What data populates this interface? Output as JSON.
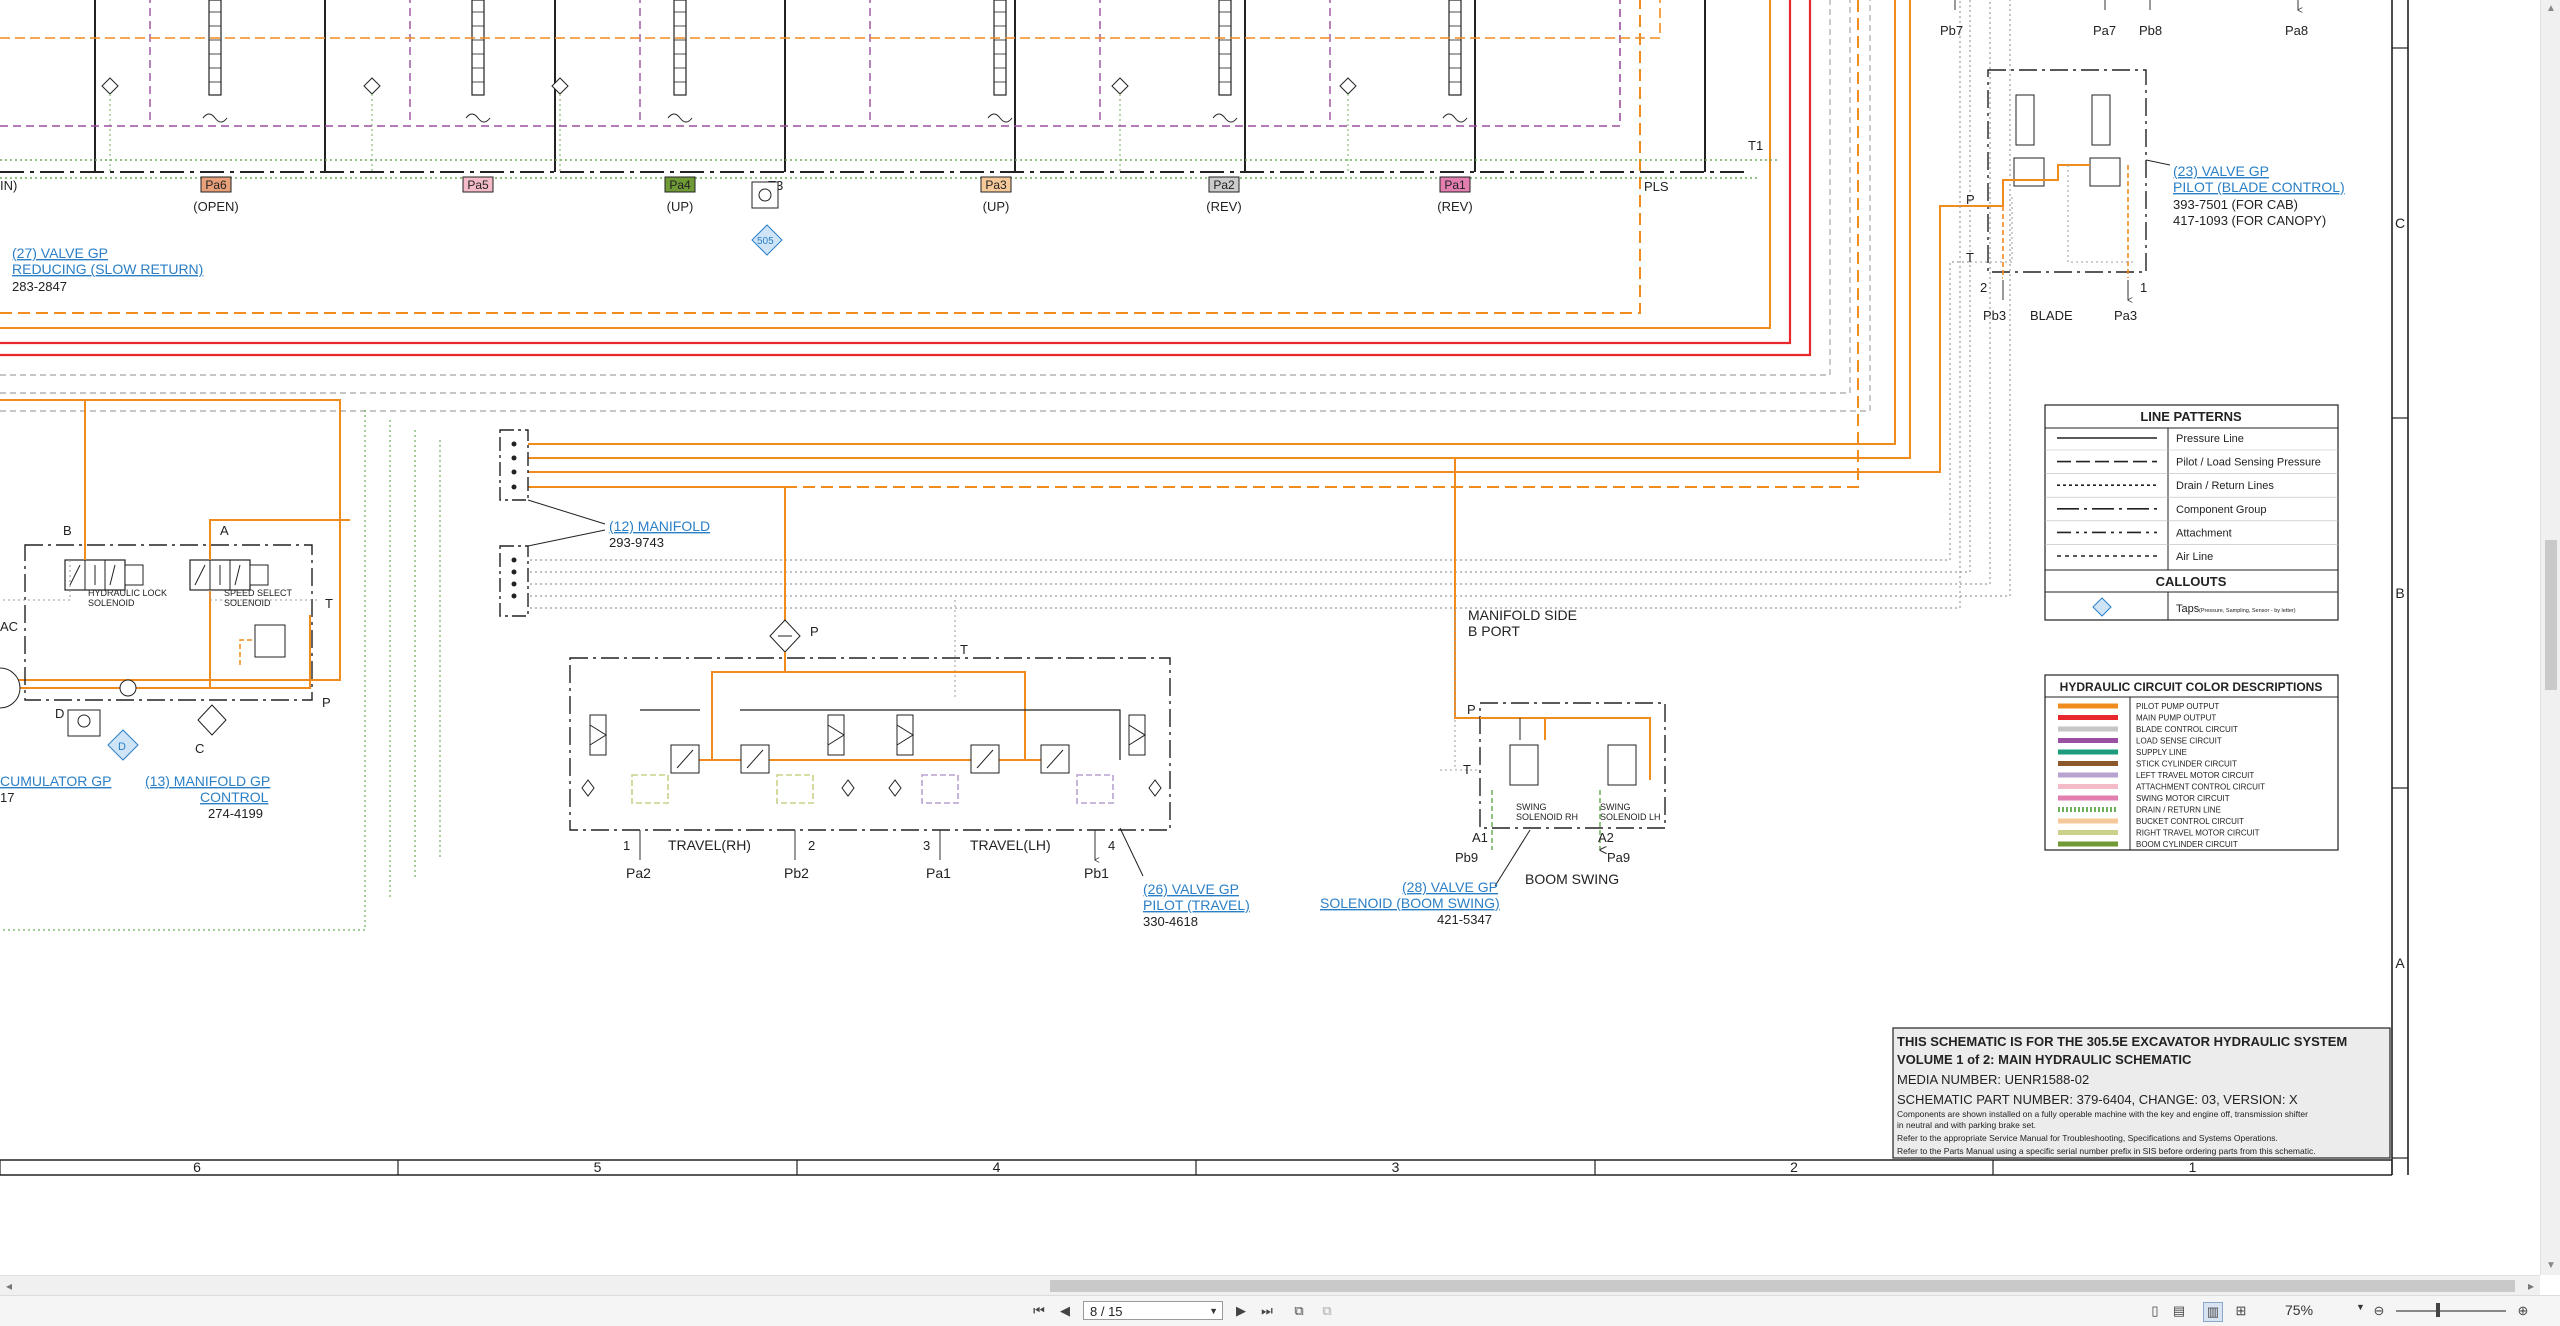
{
  "colors": {
    "pilot_pump_output": "#f08c1e",
    "main_pump_output": "#e8282d",
    "blade_control": "#c6c6c6",
    "load_sense": "#9b4fa0",
    "supply_line": "#1e9c7e",
    "stick_cylinder": "#8c5a2a",
    "left_travel_motor": "#b9a2d0",
    "attachment_control": "#f4bcc8",
    "swing_motor": "#e37fb0",
    "drain_return": "#6fae5a",
    "bucket_control": "#f6c99a",
    "right_travel_motor": "#cbd08a",
    "boom_cylinder": "#6f9a35",
    "link": "#2a7fc6",
    "tap": "#2a7fc6"
  },
  "schematic": {
    "ports_top": [
      {
        "id": "Pa6",
        "sub": "(OPEN)",
        "color": "#e8a07a"
      },
      {
        "id": "Pa5",
        "sub": "",
        "color": "#f4bcc8"
      },
      {
        "id": "Pa4",
        "sub": "(UP)",
        "color": "#6f9a35"
      },
      {
        "id": "Pa3",
        "sub": "(UP)",
        "color": "#f6c99a"
      },
      {
        "id": "Pa2",
        "sub": "(REV)",
        "color": "#cbcbcb"
      },
      {
        "id": "Pa1",
        "sub": "(REV)",
        "color": "#e37fb0"
      }
    ],
    "in_label": "IN)",
    "t3_label": "T3",
    "tap_label": "505",
    "t1_label": "T1",
    "pls_label": "PLS",
    "top_right_ports": [
      "Pb7",
      "Pa7",
      "Pb8",
      "Pa8"
    ],
    "valve27": {
      "title": "(27) VALVE GP",
      "sub": "REDUCING (SLOW RETURN)",
      "part": "283-2847"
    },
    "valve23": {
      "title": "(23) VALVE GP",
      "sub": "PILOT (BLADE CONTROL)",
      "part1": "393-7501 (FOR CAB)",
      "part2": "417-1093 (FOR CANOPY)"
    },
    "blade": {
      "p": "P",
      "t": "T",
      "n2": "2",
      "n1": "1",
      "pb3": "Pb3",
      "blade": "BLADE",
      "pa3": "Pa3"
    },
    "manifold12": {
      "title": "(12) MANIFOLD",
      "part": "293-9743"
    },
    "manifold13": {
      "title": "(13) MANIFOLD GP",
      "sub": "CONTROL",
      "part": "274-4199"
    },
    "accumulator": {
      "title": "CUMULATOR GP",
      "part": "17",
      "ac": "AC"
    },
    "solenoids": {
      "b": "B",
      "a": "A",
      "t": "T",
      "p": "P",
      "d": "D",
      "c": "C",
      "tap_d": "D",
      "lock": "HYDRAULIC LOCK",
      "lock2": "SOLENOID",
      "speed": "SPEED SELECT",
      "speed2": "SOLENOID"
    },
    "travel": {
      "p": "P",
      "t": "T",
      "rh": "TRAVEL(RH)",
      "lh": "TRAVEL(LH)",
      "n1": "1",
      "n2": "2",
      "n3": "3",
      "n4": "4",
      "pa2": "Pa2",
      "pb2": "Pb2",
      "pa1": "Pa1",
      "pb1": "Pb1"
    },
    "valve26": {
      "title": "(26) VALVE GP",
      "sub": "PILOT (TRAVEL)",
      "part": "330-4618"
    },
    "manifold_side": {
      "l1": "MANIFOLD SIDE",
      "l2": "B PORT"
    },
    "swing": {
      "p": "P",
      "t": "T",
      "a1": "A1",
      "a2": "A2",
      "pb9": "Pb9",
      "pa9": "Pa9",
      "rh1": "SWING",
      "rh2": "SOLENOID RH",
      "lh1": "SWING",
      "lh2": "SOLENOID LH",
      "boom": "BOOM SWING"
    },
    "valve28": {
      "title": "(28) VALVE GP",
      "sub": "SOLENOID (BOOM SWING)",
      "part": "421-5347"
    }
  },
  "line_patterns": {
    "title": "LINE PATTERNS",
    "items": [
      "Pressure Line",
      "Pilot / Load Sensing Pressure",
      "Drain / Return Lines",
      "Component Group",
      "Attachment",
      "Air Line"
    ],
    "callouts_title": "CALLOUTS",
    "taps": "Taps",
    "taps_note": "(Pressure, Sampling, Sensor - by letter)"
  },
  "color_legend": {
    "title": "HYDRAULIC CIRCUIT COLOR DESCRIPTIONS",
    "items": [
      {
        "label": "PILOT PUMP OUTPUT",
        "color": "#f08c1e",
        "dash": false
      },
      {
        "label": "MAIN PUMP OUTPUT",
        "color": "#e8282d",
        "dash": false
      },
      {
        "label": "BLADE CONTROL CIRCUIT",
        "color": "#c6c6c6",
        "dash": false
      },
      {
        "label": "LOAD SENSE CIRCUIT",
        "color": "#9b4fa0",
        "dash": false
      },
      {
        "label": "SUPPLY LINE",
        "color": "#1e9c7e",
        "dash": false
      },
      {
        "label": "STICK CYLINDER CIRCUIT",
        "color": "#8c5a2a",
        "dash": false
      },
      {
        "label": "LEFT TRAVEL MOTOR CIRCUIT",
        "color": "#b9a2d0",
        "dash": false
      },
      {
        "label": "ATTACHMENT CONTROL CIRCUIT",
        "color": "#f4bcc8",
        "dash": false
      },
      {
        "label": "SWING MOTOR CIRCUIT",
        "color": "#e37fb0",
        "dash": false
      },
      {
        "label": "DRAIN / RETURN LINE",
        "color": "#6fae5a",
        "dash": true
      },
      {
        "label": "BUCKET CONTROL CIRCUIT",
        "color": "#f6c99a",
        "dash": false
      },
      {
        "label": "RIGHT TRAVEL MOTOR CIRCUIT",
        "color": "#cbd08a",
        "dash": false
      },
      {
        "label": "BOOM CYLINDER CIRCUIT",
        "color": "#6f9a35",
        "dash": false
      }
    ]
  },
  "title_block": {
    "l1": "THIS SCHEMATIC IS FOR THE 305.5E EXCAVATOR HYDRAULIC SYSTEM",
    "l2": "VOLUME 1 of 2: MAIN HYDRAULIC SCHEMATIC",
    "l3": "MEDIA NUMBER: UENR1588-02",
    "l4": "SCHEMATIC PART NUMBER: 379-6404, CHANGE: 03, VERSION: X",
    "n1": "Components are shown installed on a fully operable machine with the key and engine off, transmission shifter",
    "n2": "in neutral and with parking brake set.",
    "n3": "Refer to the appropriate Service Manual for Troubleshooting, Specifications and Systems Operations.",
    "n4": "Refer to the Parts Manual using a specific serial number prefix in SIS before ordering parts from this schematic."
  },
  "grid": {
    "columns": [
      "6",
      "5",
      "4",
      "3",
      "2",
      "1"
    ],
    "rows": [
      "C",
      "B",
      "A"
    ]
  },
  "viewer": {
    "page": "8 / 15",
    "zoom": "75%"
  }
}
